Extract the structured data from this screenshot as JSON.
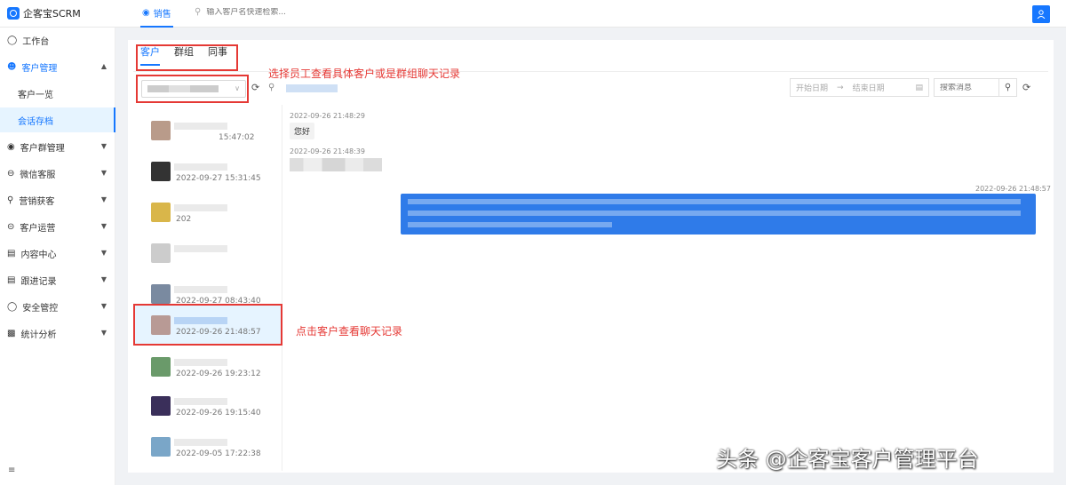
{
  "app": {
    "title": "企客宝SCRM"
  },
  "topnav": {
    "tab_label": "销售",
    "search_placeholder": "输入客户名快速检索..."
  },
  "sidebar": {
    "items": [
      {
        "label": "工作台",
        "icon": "dashboard-icon"
      },
      {
        "label": "客户管理",
        "icon": "users-icon",
        "open": true
      },
      {
        "label": "客户群管理",
        "icon": "group-icon"
      },
      {
        "label": "微信客服",
        "icon": "service-icon"
      },
      {
        "label": "营销获客",
        "icon": "bulb-icon"
      },
      {
        "label": "客户运营",
        "icon": "operation-icon"
      },
      {
        "label": "内容中心",
        "icon": "content-icon"
      },
      {
        "label": "跟进记录",
        "icon": "record-icon"
      },
      {
        "label": "安全管控",
        "icon": "shield-icon"
      },
      {
        "label": "统计分析",
        "icon": "chart-icon"
      }
    ],
    "subitems": [
      {
        "label": "客户一览"
      },
      {
        "label": "会话存档",
        "active": true
      }
    ]
  },
  "tabs": [
    {
      "label": "客户",
      "active": true
    },
    {
      "label": "群组"
    },
    {
      "label": "同事"
    }
  ],
  "filters": {
    "date_start_placeholder": "开始日期",
    "date_end_placeholder": "结束日期",
    "message_search_placeholder": "搜索消息"
  },
  "customers": [
    {
      "time": "15:47:02"
    },
    {
      "time": "2022-09-27 15:31:45"
    },
    {
      "time": "202"
    },
    {
      "time": ""
    },
    {
      "time": "2022-09-27 08:43:40"
    },
    {
      "time": "2022-09-26 21:48:57",
      "selected": true
    },
    {
      "time": "2022-09-26 19:23:12"
    },
    {
      "time": "2022-09-26 19:15:40"
    },
    {
      "time": "2022-09-05 17:22:38"
    }
  ],
  "messages": [
    {
      "time": "2022-09-26 21:48:29",
      "text": "您好"
    },
    {
      "time": "2022-09-26 21:48:39"
    },
    {
      "time": "2022-09-26 21:48:57"
    }
  ],
  "annotations": {
    "tabs_hint": "选择员工查看具体客户或是群组聊天记录",
    "customer_hint": "点击客户查看聊天记录"
  },
  "watermark": "头条 @企客宝客户管理平台",
  "colors": {
    "accent": "#1677ff",
    "self_bubble": "#2f7be9",
    "annotation": "#e53935"
  }
}
